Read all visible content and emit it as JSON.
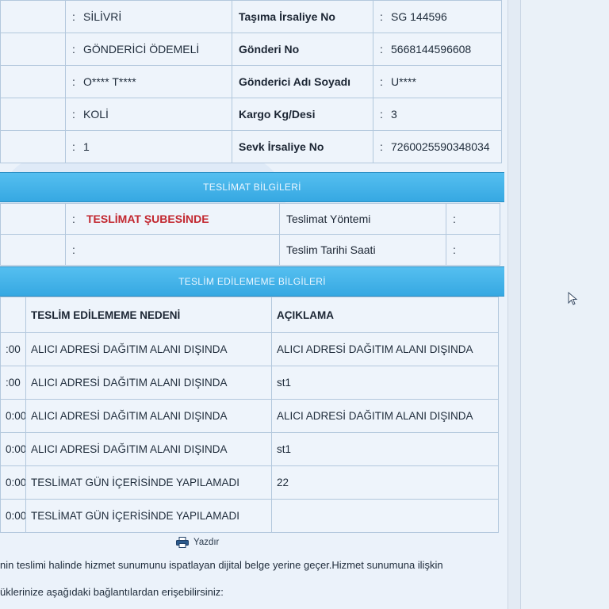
{
  "info_rows": [
    {
      "left_value": "SİLİVRİ",
      "right_label": "Taşıma İrsaliye No",
      "right_value": "SG 144596"
    },
    {
      "left_value": "GÖNDERİCİ ÖDEMELİ",
      "right_label": "Gönderi No",
      "right_value": "5668144596608"
    },
    {
      "left_value": "O**** T****",
      "right_label": "Gönderici Adı Soyadı",
      "right_value": "U****"
    },
    {
      "left_value": "KOLİ",
      "right_label": "Kargo Kg/Desi",
      "right_value": "3"
    },
    {
      "left_value": "1",
      "right_label": "Sevk İrsaliye No",
      "right_value": "7260025590348034"
    }
  ],
  "colon": ":",
  "delivery_section": {
    "title": "TESLİMAT BİLGİLERİ",
    "status_value": "TESLİMAT ŞUBESİNDE",
    "method_label": "Teslimat Yöntemi",
    "date_label": "Teslim Tarihi Saati"
  },
  "failure_section": {
    "title": "TESLİM EDİLEMEME BİLGİLERİ",
    "headers": [
      "TESLİM EDİLEMEME NEDENİ",
      "AÇIKLAMA"
    ],
    "rows": [
      {
        "time": ":00",
        "reason": "ALICI ADRESİ DAĞITIM ALANI DIŞINDA",
        "note": "ALICI ADRESİ DAĞITIM ALANI DIŞINDA"
      },
      {
        "time": ":00",
        "reason": "ALICI ADRESİ DAĞITIM ALANI DIŞINDA",
        "note": "st1"
      },
      {
        "time": "0:00",
        "reason": "ALICI ADRESİ DAĞITIM ALANI DIŞINDA",
        "note": "ALICI ADRESİ DAĞITIM ALANI DIŞINDA"
      },
      {
        "time": "0:00",
        "reason": "ALICI ADRESİ DAĞITIM ALANI DIŞINDA",
        "note": "st1"
      },
      {
        "time": "0:00",
        "reason": "TESLİMAT GÜN İÇERİSİNDE YAPILAMADI",
        "note": "22"
      },
      {
        "time": "0:00",
        "reason": "TESLİMAT GÜN İÇERİSİNDE YAPILAMADI",
        "note": ""
      }
    ]
  },
  "print_label": "Yazdır",
  "footer": {
    "line1": "nin teslimi halinde hizmet sunumunu ispatlayan dijital belge yerine geçer.Hizmet sunumuna ilişkin",
    "line2": "üklerinize aşağıdaki bağlantılardan erişebilirsiniz:"
  },
  "colors": {
    "accent": "#36a8e2",
    "status_red": "#c2262e"
  },
  "icons": {
    "print": "printer-icon",
    "cursor": "mouse-pointer-icon"
  }
}
